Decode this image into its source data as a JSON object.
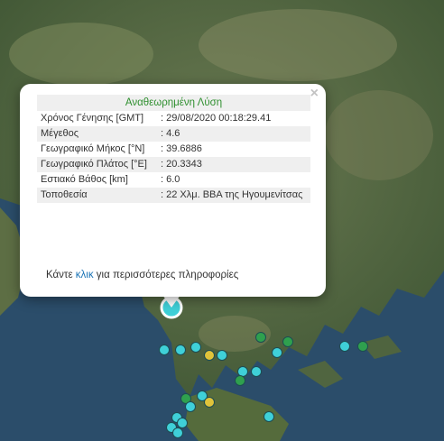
{
  "popup": {
    "title": "Αναθεωρημένη Λύση",
    "close_symbol": "×",
    "rows": [
      {
        "label": "Χρόνος Γένησης [GMT]",
        "value": ": 29/08/2020 00:18:29.41"
      },
      {
        "label": "Μέγεθος",
        "value": ": 4.6"
      },
      {
        "label": "Γεωγραφικό Μήκος [°N]",
        "value": ": 39.6886"
      },
      {
        "label": "Γεωγραφικό Πλάτος [°E]",
        "value": ": 20.3343"
      },
      {
        "label": "Εστιακό Βάθος [km]",
        "value": ": 6.0"
      },
      {
        "label": "Τοποθεσία",
        "value": ": 22 Χλμ. ΒΒΑ της Ηγουμενίτσας"
      }
    ],
    "footer_prefix": "Κάντε ",
    "footer_link": "κλικ",
    "footer_suffix": " για περισσότερες πληροφορίες"
  },
  "colors": {
    "marker_cyan": "#3fd0d8",
    "marker_green": "#2fa04e",
    "marker_yellow": "#e0c33a",
    "title_text": "#2f8f2f",
    "link": "#1a73b5"
  }
}
